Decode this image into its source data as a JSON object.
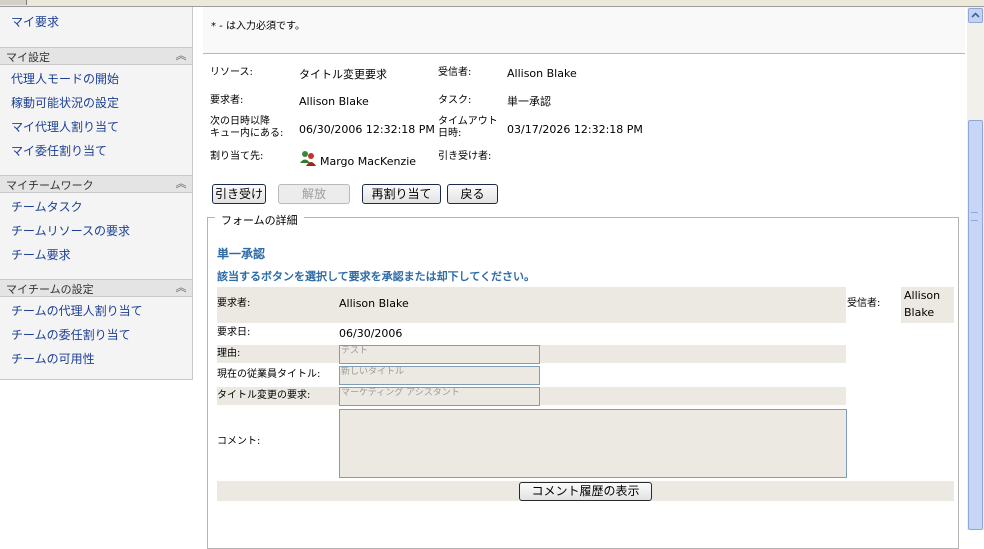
{
  "sidebar": {
    "top_link": "マイ要求",
    "sections": [
      {
        "title": "マイ設定",
        "items": [
          "代理人モードの開始",
          "稼動可能状況の設定",
          "マイ代理人割り当て",
          "マイ委任割り当て"
        ]
      },
      {
        "title": "マイチームワーク",
        "items": [
          "チームタスク",
          "チームリソースの要求",
          "チーム要求"
        ]
      },
      {
        "title": "マイチームの設定",
        "items": [
          "チームの代理人割り当て",
          "チームの委任割り当て",
          "チームの可用性"
        ]
      }
    ]
  },
  "required_note": "* - は入力必須です。",
  "task": {
    "resource_label": "リソース:",
    "resource_value": "タイトル変更要求",
    "recipient_label": "受信者:",
    "recipient_value": "Allison Blake",
    "requester_label": "要求者:",
    "requester_value": "Allison Blake",
    "task_label": "タスク:",
    "task_value": "単一承認",
    "queue_label_1": "次の日時以降",
    "queue_label_2": "キュー内にある:",
    "queue_value": "06/30/2006 12:32:18 PM",
    "timeout_label_1": "タイムアウト",
    "timeout_label_2": "日時:",
    "timeout_value": "03/17/2026 12:32:18 PM",
    "assigned_label": "割り当て先:",
    "assigned_value": "Margo MacKenzie",
    "claimed_label": "引き受け者:",
    "claimed_value": ""
  },
  "buttons": {
    "claim": "引き受け",
    "release": "解放",
    "reassign": "再割り当て",
    "back": "戻る",
    "comment_history": "コメント履歴の表示"
  },
  "form": {
    "legend": "フォームの詳細",
    "title": "単一承認",
    "instruction": "該当するボタンを選択して要求を承認または却下してください。",
    "requester_label": "要求者:",
    "requester_value": "Allison Blake",
    "recipient_label": "受信者:",
    "recipient_value_1": "Allison",
    "recipient_value_2": "Blake",
    "request_date_label": "要求日:",
    "request_date_value": "06/30/2006",
    "reason_label": "理由:",
    "reason_value": "テスト",
    "current_title_label": "現在の従業員タイトル:",
    "current_title_value": "新しいタイトル",
    "requested_title_label": "タイトル変更の要求:",
    "requested_title_value": "マーケティング アシスタント",
    "comment_label": "コメント:",
    "comment_value": ""
  },
  "colors": {
    "link": "#1c3f95",
    "form_heading": "#2e6ca6",
    "row_bg": "#ebe9e2"
  },
  "icons": {
    "assigned_user": "user-group-icon",
    "collapse": "chevron-up-icon"
  }
}
